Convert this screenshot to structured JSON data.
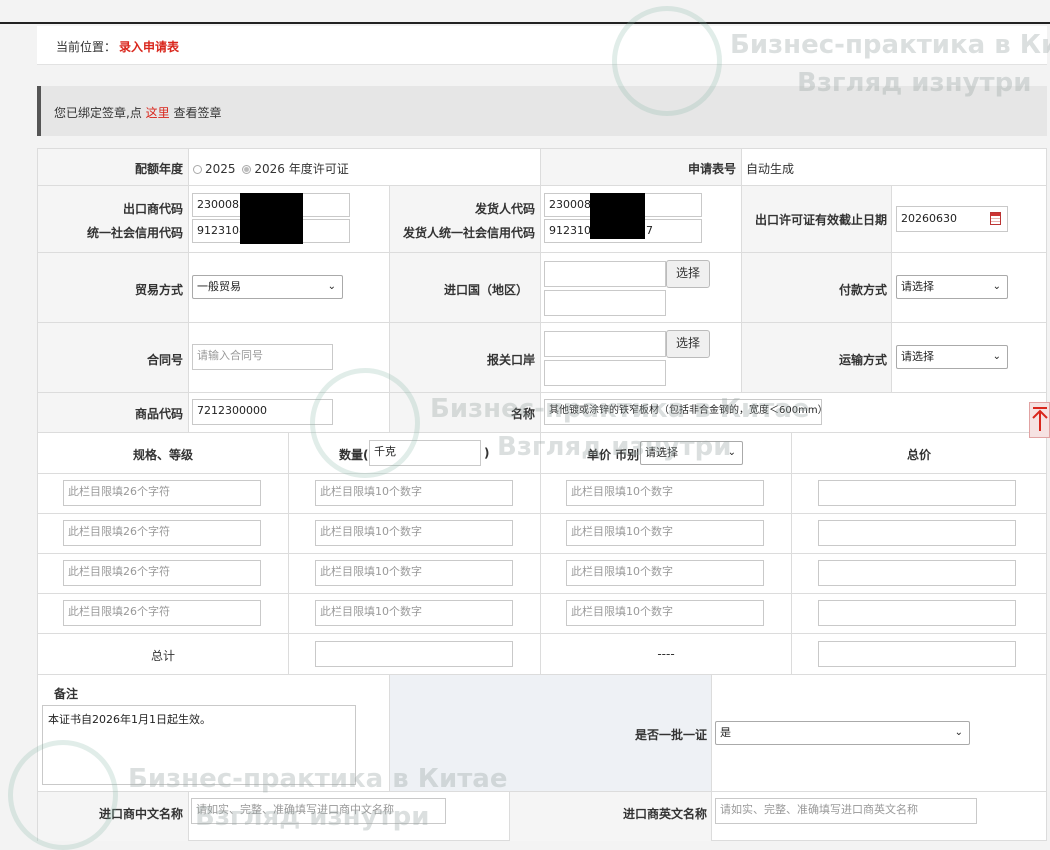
{
  "breadcrumb": {
    "prefix": "当前位置：",
    "current": "录入申请表"
  },
  "notice": {
    "before": "您已绑定签章,点 ",
    "link": "这里",
    "after": " 查看签章"
  },
  "quota_year": {
    "label": "配额年度",
    "opt1": "2025",
    "opt2": "2026 年度许可证"
  },
  "app_no": {
    "label": "申请表号",
    "value": "自动生成"
  },
  "exporter_code": {
    "label": "出口商代码",
    "value": "23000832"
  },
  "exporter_credit": {
    "label": "统一社会信用代码",
    "value": "9123108"
  },
  "consignor_code": {
    "label": "发货人代码",
    "value": "23000832"
  },
  "consignor_credit": {
    "label": "发货人统一社会信用代码",
    "value": "91231081",
    "suffix": "7"
  },
  "expiry": {
    "label": "出口许可证有效截止日期",
    "value": "20260630"
  },
  "trade_mode": {
    "label": "贸易方式",
    "value": "一般贸易"
  },
  "dest_country": {
    "label": "进口国（地区）",
    "button": "选择"
  },
  "payment": {
    "label": "付款方式",
    "value": "请选择"
  },
  "contract": {
    "label": "合同号",
    "placeholder": "请输入合同号"
  },
  "port": {
    "label": "报关口岸",
    "button": "选择"
  },
  "transport": {
    "label": "运输方式",
    "value": "请选择"
  },
  "goods_code": {
    "label": "商品代码",
    "value": "7212300000"
  },
  "goods_name": {
    "label": "名称",
    "value": "其他镀或涂锌的铁窄板材（包括非合金钢的，宽度＜600mm）"
  },
  "spec_table": {
    "h_spec": "规格、等级",
    "h_qty": "数量(",
    "h_qty_unit": "千克",
    "h_qty_close": ")",
    "h_price": "单价 币别",
    "h_currency": "请选择",
    "h_total": "总价",
    "ph_spec": "此栏目限填26个字符",
    "ph_num": "此栏目限填10个数字",
    "total_label": "总计",
    "dash": "----"
  },
  "remarks": {
    "label": "备注",
    "value": "本证书自2026年1月1日起生效。"
  },
  "one_batch": {
    "label": "是否一批一证",
    "value": "是"
  },
  "importer_cn": {
    "label": "进口商中文名称",
    "placeholder": "请如实、完整、准确填写进口商中文名称"
  },
  "importer_en": {
    "label": "进口商英文名称",
    "placeholder": "请如实、完整、准确填写进口商英文名称"
  },
  "watermark": {
    "line1": "Бизнес-практика в Китае",
    "line2": "Взгляд изнутри"
  }
}
